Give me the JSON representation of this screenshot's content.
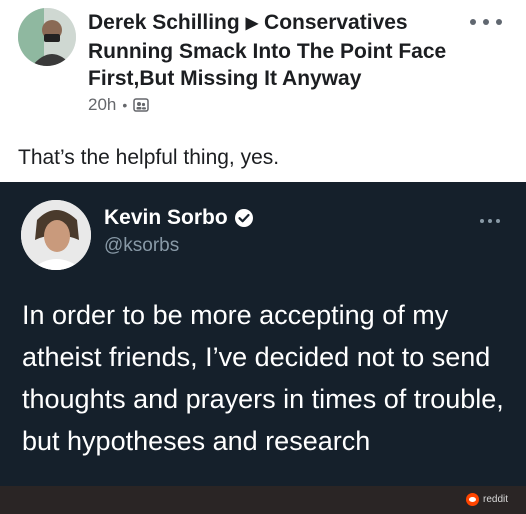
{
  "post": {
    "author": "Derek Schilling",
    "group": "Conservatives Running Smack Into The Point Face First,But Missing It Anyway",
    "time": "20h",
    "caption": "That’s the helpful thing, yes."
  },
  "tweet": {
    "name": "Kevin Sorbo",
    "handle": "@ksorbs",
    "text": "In order to be more accepting of my atheist friends, I’ve decided not to send thoughts and prayers in times of trouble, but hypotheses and research"
  },
  "watermark": {
    "label": "reddit"
  },
  "colors": {
    "tweet_bg": "#15202b",
    "verified": "#ffffff",
    "reddit": "#ff4500"
  }
}
